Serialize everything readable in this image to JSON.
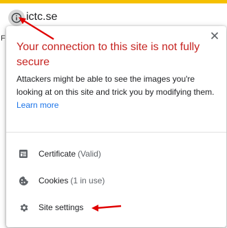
{
  "address_bar": {
    "url": "ictc.se",
    "info_icon": "info-icon"
  },
  "page": {
    "edge_letter": "F"
  },
  "popup": {
    "headline": "Your connection to this site is not fully secure",
    "description": "Attackers might be able to see the images you're looking at on this site and trick you by modifying them.",
    "learn_more": "Learn more",
    "close_icon": "close-icon",
    "items": [
      {
        "label": "Certificate",
        "sub": "(Valid)",
        "icon": "certificate-icon"
      },
      {
        "label": "Cookies",
        "sub": "(1 in use)",
        "icon": "cookie-icon"
      },
      {
        "label": "Site settings",
        "sub": "",
        "icon": "gear-icon"
      }
    ]
  },
  "colors": {
    "top_strip": "#f5c000",
    "warning_text": "#c5221f",
    "link": "#1a73e8",
    "annotation_arrow": "#e00000"
  }
}
